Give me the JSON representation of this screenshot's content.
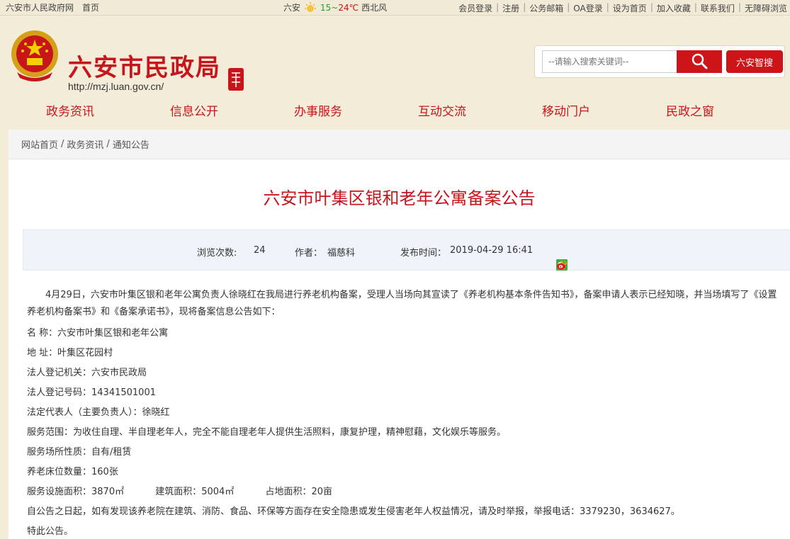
{
  "topbar": {
    "links_left": [
      "六安市人民政府网",
      "首页"
    ],
    "weather_city": "六安",
    "weather_low": "15",
    "weather_sep": "~",
    "weather_high": "24℃",
    "weather_wind": "西北风",
    "links_right": [
      "会员登录",
      "注册",
      "公务邮箱",
      "OA登录",
      "设为首页",
      "加入收藏",
      "联系我们",
      "无障碍浏览"
    ]
  },
  "header": {
    "site_title": "六安市民政局",
    "site_url": "http://mzj.luan.gov.cn/",
    "search_placeholder": "--请输入搜索关键词--",
    "smart_search_label": "六安智搜"
  },
  "nav": {
    "items": [
      "政务资讯",
      "信息公开",
      "办事服务",
      "互动交流",
      "移动门户",
      "民政之窗"
    ]
  },
  "breadcrumb": {
    "items": [
      "网站首页",
      "政务资讯",
      "通知公告"
    ],
    "separator": "/"
  },
  "article": {
    "title": "六安市叶集区银和老年公寓备案公告",
    "views_label": "浏览次数:",
    "views_value": "24",
    "author_label": "作者：",
    "author_value": "福慈科",
    "date_label": "发布时间：",
    "date_value": "2019-04-29 16:41",
    "intro": "4月29日，六安市叶集区银和老年公寓负责人徐晓红在我局进行养老机构备案，受理人当场向其宣读了《养老机构基本条件告知书》，备案申请人表示已经知晓，并当场填写了《设置养老机构备案书》和《备案承诺书》，现将备案信息公告如下：",
    "lines": [
      "名  称：六安市叶集区银和老年公寓",
      "地  址：叶集区花园村",
      "法人登记机关：六安市民政局",
      "法人登记号码：14341501001",
      "法定代表人（主要负责人）：徐晓红",
      "服务范围：为收住自理、半自理老年人，完全不能自理老年人提供生活照料，康复护理，精神慰藉，文化娱乐等服务。",
      "服务场所性质：自有/租赁",
      "养老床位数量：160张"
    ],
    "area_service": "服务设施面积：3870㎡",
    "area_building": "建筑面积：5004㎡",
    "area_land": "占地面积：20亩",
    "notice": "自公告之日起，如有发现该养老院在建筑、消防、食品、环保等方面存在安全隐患或发生侵害老年人权益情况，请及时举报，举报电话：3379230，3634627。",
    "closing": "特此公告。"
  },
  "colors": {
    "brand_red": "#c8141b",
    "page_bg": "#f3ecd9",
    "meta_bg": "#eef4fa"
  },
  "icons": [
    "sun-icon",
    "search-icon",
    "share-plus-icon",
    "wechat-icon",
    "qzone-icon",
    "weibo-icon"
  ]
}
